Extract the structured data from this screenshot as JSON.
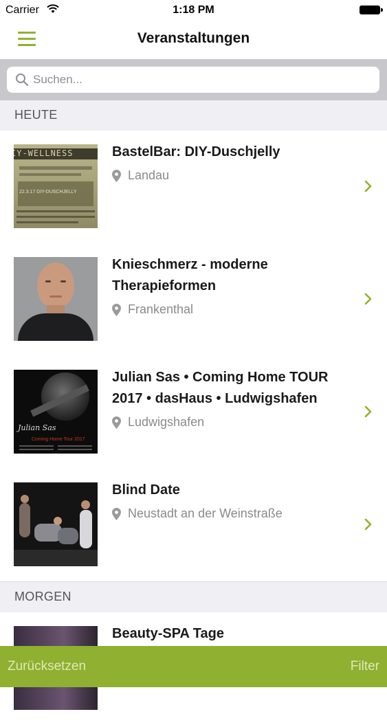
{
  "status_bar": {
    "carrier": "Carrier",
    "time": "1:18 PM"
  },
  "nav": {
    "title": "Veranstaltungen",
    "menu_icon": "hamburger-icon"
  },
  "search": {
    "placeholder": "Suchen..."
  },
  "sections": [
    {
      "label": "HEUTE"
    },
    {
      "label": "MORGEN"
    }
  ],
  "events": [
    {
      "title": "BastelBar: DIY-Duschjelly",
      "location": "Landau",
      "thumb_text": "IY-WELLNESS",
      "thumb_caption": "22.3.17 DIY-DUSCHJELLY"
    },
    {
      "title": "Knieschmerz - moderne Therapieformen",
      "location": "Frankenthal"
    },
    {
      "title": "Julian Sas • Coming Home TOUR 2017 • dasHaus • Ludwigshafen",
      "location": "Ludwigshafen",
      "thumb_text": "Julian Sas",
      "thumb_caption": "Coming Home Tour 2017"
    },
    {
      "title": "Blind Date",
      "location": "Neustadt an der Weinstraße"
    },
    {
      "title": "Beauty-SPA Tage",
      "location": ""
    }
  ],
  "toolbar": {
    "reset": "Zurücksetzen",
    "filter": "Filter"
  },
  "colors": {
    "accent": "#8fb030",
    "section_bg": "#efeff4",
    "search_bar_bg": "#c8c8cc"
  }
}
